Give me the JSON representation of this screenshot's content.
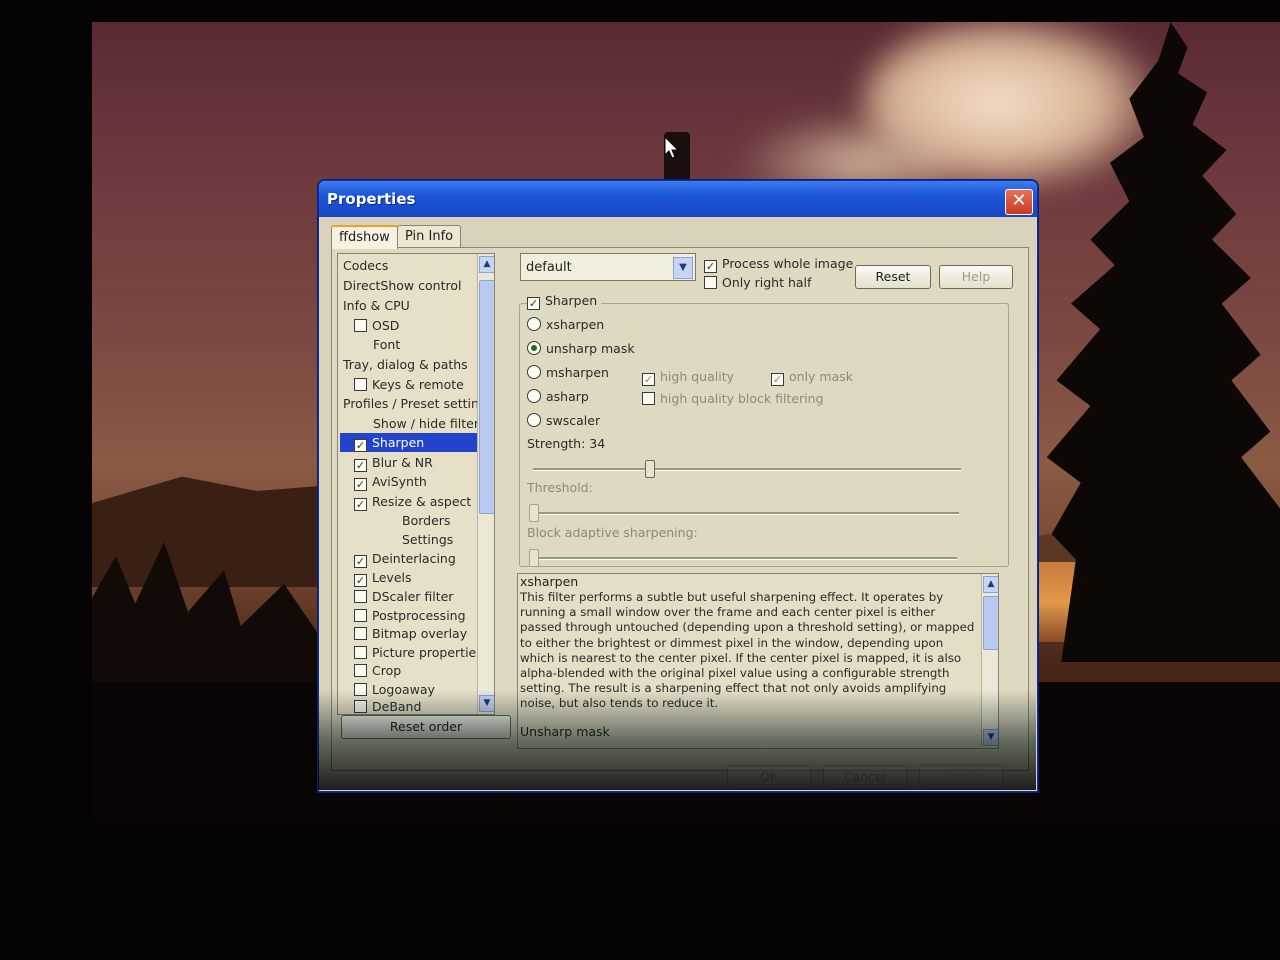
{
  "window": {
    "title": "Properties",
    "close_label": "✕"
  },
  "tabs": [
    {
      "label": "ffdshow",
      "active": true
    },
    {
      "label": "Pin Info",
      "active": false
    }
  ],
  "filter_tree": {
    "items": [
      {
        "label": "Codecs"
      },
      {
        "label": "DirectShow control"
      },
      {
        "label": "Info & CPU"
      },
      {
        "label": "OSD",
        "checked": false
      },
      {
        "label": "Font"
      },
      {
        "label": "Tray, dialog & paths"
      },
      {
        "label": "Keys & remote",
        "checked": false
      },
      {
        "label": "Profiles / Preset settings"
      },
      {
        "label": "Show / hide filters"
      },
      {
        "label": "Sharpen",
        "checked": true,
        "selected": true
      },
      {
        "label": "Blur & NR",
        "checked": true
      },
      {
        "label": "AviSynth",
        "checked": true
      },
      {
        "label": "Resize & aspect",
        "checked": true
      },
      {
        "label": "Borders"
      },
      {
        "label": "Settings"
      },
      {
        "label": "Deinterlacing",
        "checked": true
      },
      {
        "label": "Levels",
        "checked": true
      },
      {
        "label": "DScaler filter",
        "checked": false
      },
      {
        "label": "Postprocessing",
        "checked": false
      },
      {
        "label": "Bitmap overlay",
        "checked": false
      },
      {
        "label": "Picture properties",
        "checked": false
      },
      {
        "label": "Crop",
        "checked": false
      },
      {
        "label": "Logoaway",
        "checked": false
      },
      {
        "label": "DeBand",
        "checked": false
      }
    ],
    "reset_order_label": "Reset order"
  },
  "preset": {
    "value": "default"
  },
  "options": {
    "process_whole_image": "Process whole image",
    "only_right_half": "Only right half",
    "reset_label": "Reset",
    "help_label": "Help"
  },
  "sharpen": {
    "enable_label": "Sharpen",
    "methods": [
      {
        "label": "xsharpen",
        "selected": false
      },
      {
        "label": "unsharp mask",
        "selected": true
      },
      {
        "label": "msharpen",
        "selected": false
      },
      {
        "label": "asharp",
        "selected": false
      },
      {
        "label": "swscaler",
        "selected": false
      }
    ],
    "high_quality": "high quality",
    "only_mask": "only mask",
    "hq_block_filtering": "high quality block filtering",
    "strength_label": "Strength: 34",
    "strength_fraction": 0.27,
    "threshold_label": "Threshold:",
    "threshold_fraction": 0.0,
    "block_adaptive_label": "Block adaptive sharpening:",
    "block_adaptive_fraction": 0.0
  },
  "description": {
    "title": "xsharpen",
    "text": "This filter performs a subtle but useful sharpening effect. It operates by running a small window over the frame and each center pixel is either passed through untouched (depending upon a threshold setting), or mapped to either the brightest or dimmest pixel in the window, depending upon which is nearest to the center pixel. If the center pixel is mapped, it is also alpha-blended with the original pixel value using a configurable strength setting. The result is a sharpening effect that not only avoids amplifying noise, but also tends to reduce it.",
    "next_title": "Unsharp mask"
  },
  "footer": {
    "ok_label": "OK",
    "cancel_label": "Cancel",
    "apply_label": "Apply"
  }
}
